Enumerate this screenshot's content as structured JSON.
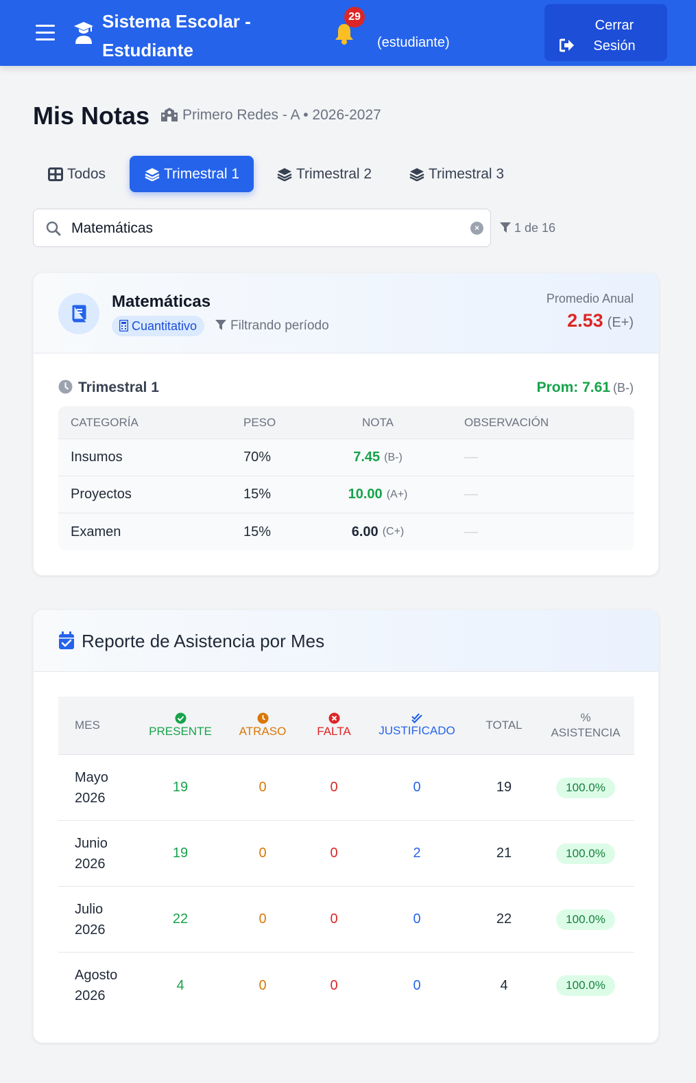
{
  "header": {
    "title": "Sistema Escolar - Estudiante",
    "notifications_count": "29",
    "role": "(estudiante)",
    "logout_label": "Cerrar Sesión"
  },
  "page": {
    "title": "Mis Notas",
    "subtitle": "Primero Redes - A • 2026-2027"
  },
  "tabs": [
    {
      "label": "Todos",
      "active": false
    },
    {
      "label": "Trimestral 1",
      "active": true
    },
    {
      "label": "Trimestral 2",
      "active": false
    },
    {
      "label": "Trimestral 3",
      "active": false
    }
  ],
  "search": {
    "value": "Matemáticas",
    "result_count": "1 de 16"
  },
  "subject": {
    "name": "Matemáticas",
    "type_badge": "Cuantitativo",
    "filter_note": "Filtrando período",
    "annual_label": "Promedio Anual",
    "annual_value": "2.53",
    "annual_grade": "(E+)",
    "period": {
      "title": "Trimestral 1",
      "avg_label": "Prom: 7.61",
      "avg_grade": "(B-)",
      "columns": [
        "CATEGORÍA",
        "PESO",
        "NOTA",
        "OBSERVACIÓN"
      ],
      "rows": [
        {
          "category": "Insumos",
          "weight": "70%",
          "grade": "7.45",
          "letter": "(B-)",
          "obs": "—",
          "color": "#16a34a"
        },
        {
          "category": "Proyectos",
          "weight": "15%",
          "grade": "10.00",
          "letter": "(A+)",
          "obs": "—",
          "color": "#16a34a"
        },
        {
          "category": "Examen",
          "weight": "15%",
          "grade": "6.00",
          "letter": "(C+)",
          "obs": "—",
          "color": "#1f2937"
        }
      ]
    }
  },
  "attendance": {
    "title": "Reporte de Asistencia por Mes",
    "columns": {
      "month": "MES",
      "present": "PRESENTE",
      "late": "ATRASO",
      "absent": "FALTA",
      "justified": "JUSTIFICADO",
      "total": "TOTAL",
      "pct_line1": "%",
      "pct_line2": "ASISTENCIA"
    },
    "rows": [
      {
        "month_line1": "Mayo",
        "month_line2": "2026",
        "present": "19",
        "late": "0",
        "absent": "0",
        "justified": "0",
        "total": "19",
        "pct": "100.0%"
      },
      {
        "month_line1": "Junio",
        "month_line2": "2026",
        "present": "19",
        "late": "0",
        "absent": "0",
        "justified": "2",
        "total": "21",
        "pct": "100.0%"
      },
      {
        "month_line1": "Julio",
        "month_line2": "2026",
        "present": "22",
        "late": "0",
        "absent": "0",
        "justified": "0",
        "total": "22",
        "pct": "100.0%"
      },
      {
        "month_line1": "Agosto",
        "month_line2": "2026",
        "present": "4",
        "late": "0",
        "absent": "0",
        "justified": "0",
        "total": "4",
        "pct": "100.0%"
      }
    ]
  },
  "colors": {
    "primary": "#2563eb",
    "success": "#16a34a",
    "warning": "#d97706",
    "danger": "#dc2626"
  }
}
